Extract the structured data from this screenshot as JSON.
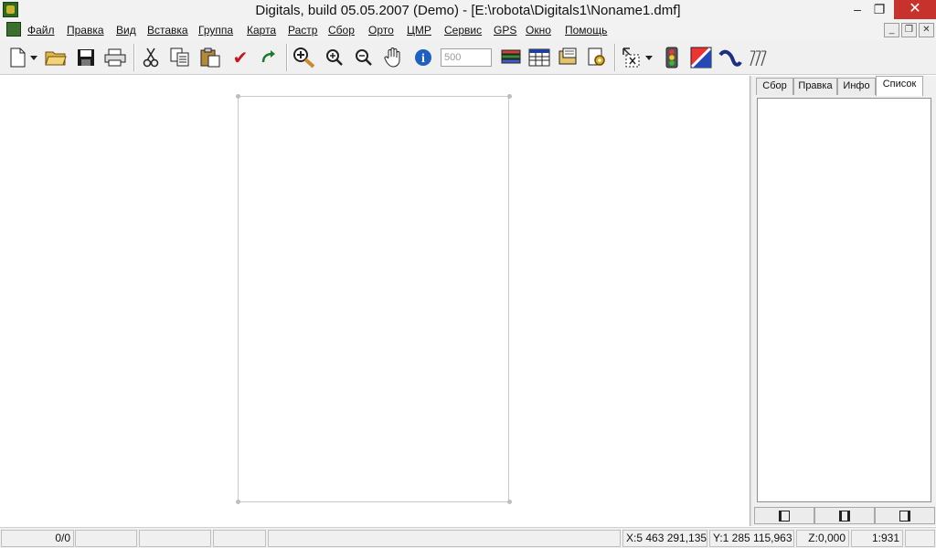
{
  "window": {
    "title": "Digitals, build 05.05.2007 (Demo) - [E:\\robota\\Digitals1\\Noname1.dmf]",
    "controls": {
      "minimize": "–",
      "restore": "❐",
      "close": "✕"
    }
  },
  "menubar": {
    "items": [
      "Файл",
      "Правка",
      "Вид",
      "Вставка",
      "Группа",
      "Карта",
      "Растр",
      "Сбор",
      "Орто",
      "ЦМР",
      "Сервис",
      "GPS",
      "Окно",
      "Помощь"
    ],
    "doc_controls": {
      "minimize": "_",
      "restore": "❐",
      "close": "✕"
    }
  },
  "toolbar": {
    "icons": [
      "new-document-icon",
      "dropdown-arrow-icon",
      "open-folder-icon",
      "save-disk-icon",
      "print-icon",
      "cut-icon",
      "copy-icon",
      "paste-icon",
      "check-icon",
      "redo-icon",
      "zoom-tool-icon",
      "zoom-in-icon",
      "zoom-out-icon",
      "pan-hand-icon",
      "info-icon",
      "layers-icon",
      "table-icon",
      "open-file-icon",
      "gear-settings-icon",
      "select-cross-icon",
      "dropdown-arrow-icon",
      "traffic-light-icon",
      "flag-icon",
      "curve-icon",
      "arrows-icon"
    ],
    "scale_value": "500"
  },
  "panel": {
    "tabs": [
      "Сбор",
      "Правка",
      "Инфо",
      "Список"
    ],
    "active_tab": "Список",
    "bottom_buttons": [
      "panel-left-icon",
      "panel-split-icon",
      "panel-right-icon"
    ]
  },
  "statusbar": {
    "count": "0/0",
    "x": "X:5 463 291,135",
    "y": "Y:1 285 115,963",
    "z": "Z:0,000",
    "scale": "1:931"
  },
  "colors": {
    "accent": "#1e5fbf",
    "close_button": "#c7322c"
  }
}
